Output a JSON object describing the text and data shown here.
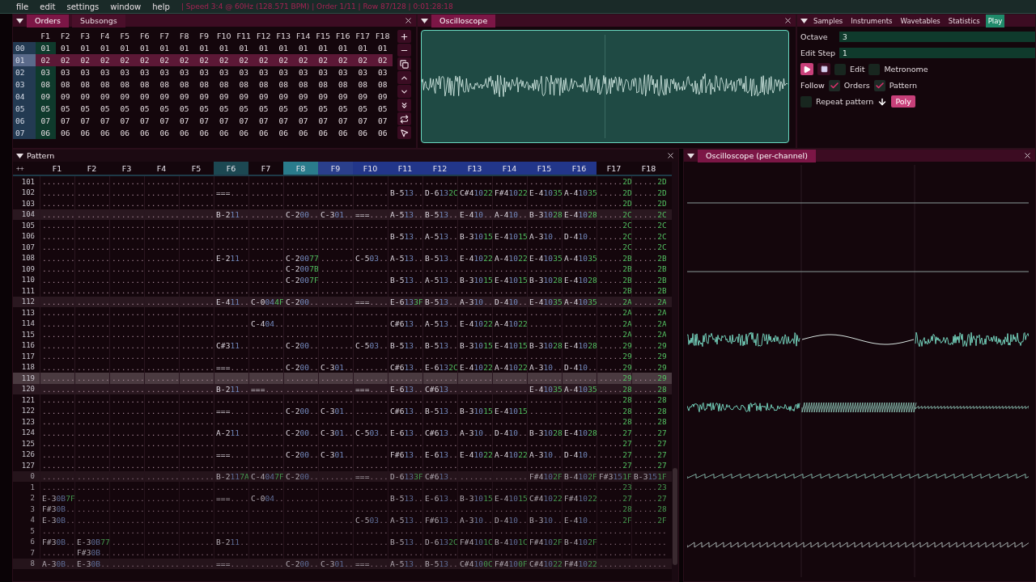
{
  "menu": {
    "items": [
      "file",
      "edit",
      "settings",
      "window",
      "help"
    ],
    "status": "| Speed 3:4 @ 60Hz (128.571 BPM) | Order 1/11 | Row 87/128 | 0:01:28:18"
  },
  "orders": {
    "tabs": [
      {
        "label": "Orders",
        "selected": true
      },
      {
        "label": "Subsongs",
        "selected": false
      }
    ],
    "columns": [
      {
        "label": "F1",
        "selected": true
      },
      {
        "label": "F2",
        "selected": false
      },
      {
        "label": "F3",
        "selected": false
      },
      {
        "label": "F4",
        "selected": false
      },
      {
        "label": "F5",
        "selected": false
      },
      {
        "label": "F6",
        "selected": false
      },
      {
        "label": "F7",
        "selected": false
      },
      {
        "label": "F8",
        "selected": false
      },
      {
        "label": "F9",
        "selected": false
      },
      {
        "label": "F10",
        "selected": false
      },
      {
        "label": "F11",
        "selected": false
      },
      {
        "label": "F12",
        "selected": false
      },
      {
        "label": "F13",
        "selected": false
      },
      {
        "label": "F14",
        "selected": false
      },
      {
        "label": "F15",
        "selected": false
      },
      {
        "label": "F16",
        "selected": false
      },
      {
        "label": "F17",
        "selected": false
      },
      {
        "label": "F18",
        "selected": false
      }
    ],
    "rows": [
      {
        "num": "00",
        "selected": false,
        "cells": [
          "01",
          "01",
          "01",
          "01",
          "01",
          "01",
          "01",
          "01",
          "01",
          "01",
          "01",
          "01",
          "01",
          "01",
          "01",
          "01",
          "01",
          "01"
        ]
      },
      {
        "num": "01",
        "selected": true,
        "cells": [
          "02",
          "02",
          "02",
          "02",
          "02",
          "02",
          "02",
          "02",
          "02",
          "02",
          "02",
          "02",
          "02",
          "02",
          "02",
          "02",
          "02",
          "02"
        ]
      },
      {
        "num": "02",
        "selected": false,
        "cells": [
          "03",
          "03",
          "03",
          "03",
          "03",
          "03",
          "03",
          "03",
          "03",
          "03",
          "03",
          "03",
          "03",
          "03",
          "03",
          "03",
          "03",
          "03"
        ]
      },
      {
        "num": "03",
        "selected": false,
        "cells": [
          "08",
          "08",
          "08",
          "08",
          "08",
          "08",
          "08",
          "08",
          "08",
          "08",
          "08",
          "08",
          "08",
          "08",
          "08",
          "08",
          "08",
          "08"
        ]
      },
      {
        "num": "04",
        "selected": false,
        "cells": [
          "09",
          "09",
          "09",
          "09",
          "09",
          "09",
          "09",
          "09",
          "09",
          "09",
          "09",
          "09",
          "09",
          "09",
          "09",
          "09",
          "09",
          "09"
        ]
      },
      {
        "num": "05",
        "selected": false,
        "cells": [
          "05",
          "05",
          "05",
          "05",
          "05",
          "05",
          "05",
          "05",
          "05",
          "05",
          "05",
          "05",
          "05",
          "05",
          "05",
          "05",
          "05",
          "05"
        ]
      },
      {
        "num": "06",
        "selected": false,
        "cells": [
          "07",
          "07",
          "07",
          "07",
          "07",
          "07",
          "07",
          "07",
          "07",
          "07",
          "07",
          "07",
          "07",
          "07",
          "07",
          "07",
          "07",
          "07"
        ]
      },
      {
        "num": "07",
        "selected": false,
        "cells": [
          "06",
          "06",
          "06",
          "06",
          "06",
          "06",
          "06",
          "06",
          "06",
          "06",
          "06",
          "06",
          "06",
          "06",
          "06",
          "06",
          "06",
          "06"
        ]
      }
    ]
  },
  "oscilloscope": {
    "title": "Oscilloscope"
  },
  "play": {
    "tabs": [
      {
        "label": "Samples",
        "selected": false
      },
      {
        "label": "Instruments",
        "selected": false
      },
      {
        "label": "Wavetables",
        "selected": false
      },
      {
        "label": "Statistics",
        "selected": false
      },
      {
        "label": "Play",
        "selected": true
      }
    ],
    "fields": [
      {
        "label": "Octave",
        "value": "3"
      },
      {
        "label": "Edit Step",
        "value": "1"
      }
    ],
    "controls": [
      {
        "kind": "play"
      },
      {
        "kind": "stop"
      },
      {
        "kind": "check",
        "label": "Edit",
        "checked": false
      },
      {
        "kind": "check",
        "label": "Metronome",
        "checked": false
      }
    ],
    "follow": {
      "label": "Follow",
      "checks": [
        {
          "label": "Orders",
          "checked": true
        },
        {
          "label": "Pattern",
          "checked": true
        }
      ]
    },
    "options": [
      {
        "kind": "check",
        "label": "Repeat pattern",
        "checked": false
      },
      {
        "kind": "arrow"
      },
      {
        "kind": "button",
        "label": "Poly",
        "on": true
      }
    ]
  },
  "pattern": {
    "title": "Pattern",
    "corner": "++",
    "channels": [
      {
        "label": "F1"
      },
      {
        "label": "F2"
      },
      {
        "label": "F3"
      },
      {
        "label": "F4"
      },
      {
        "label": "F5"
      },
      {
        "label": "F6",
        "color": "#1c4852"
      },
      {
        "label": "F7"
      },
      {
        "label": "F8",
        "color": "#2a7c8c"
      },
      {
        "label": "F9",
        "color": "#2a3f8c"
      },
      {
        "label": "F10",
        "color": "#22368a"
      },
      {
        "label": "F11",
        "color": "#22368a"
      },
      {
        "label": "F12",
        "color": "#22368a"
      },
      {
        "label": "F13",
        "color": "#22368a"
      },
      {
        "label": "F14",
        "color": "#22368a"
      },
      {
        "label": "F15",
        "color": "#22368a"
      },
      {
        "label": "F16",
        "color": "#22368a"
      },
      {
        "label": "F17"
      },
      {
        "label": "F18"
      }
    ],
    "rows": [
      {
        "num": "101",
        "beat": false,
        "selected": false,
        "preview": false,
        "cells": [
          ".......",
          ".......",
          ".......",
          ".......",
          ".......",
          ".......",
          ".......",
          ".......",
          ".......",
          ".......",
          ".......",
          ".......",
          ".......",
          ".......",
          ".......",
          ".......",
          ".....2D",
          ".....2D"
        ]
      },
      {
        "num": "102",
        "beat": false,
        "selected": false,
        "preview": false,
        "cells": [
          ".......",
          ".......",
          ".......",
          ".......",
          ".......",
          "===....",
          ".......",
          ".......",
          ".......",
          ".......",
          "B-513..",
          "D-6132C",
          "C#41022",
          "F#41022",
          "E-41035",
          "A-41035",
          ".....2D",
          ".....2D"
        ]
      },
      {
        "num": "103",
        "beat": false,
        "selected": false,
        "preview": false,
        "cells": [
          ".......",
          ".......",
          ".......",
          ".......",
          ".......",
          ".......",
          ".......",
          ".......",
          ".......",
          ".......",
          ".......",
          ".......",
          ".......",
          ".......",
          ".......",
          ".......",
          ".....2D",
          ".....2D"
        ]
      },
      {
        "num": "104",
        "beat": true,
        "selected": false,
        "preview": false,
        "cells": [
          ".......",
          ".......",
          ".......",
          ".......",
          ".......",
          "B-211..",
          ".......",
          "C-200..",
          "C-301..",
          "===....",
          "A-513..",
          "B-513..",
          "E-410..",
          "A-410..",
          "B-31028",
          "E-41028",
          ".....2C",
          ".....2C"
        ]
      },
      {
        "num": "105",
        "beat": false,
        "selected": false,
        "preview": false,
        "cells": [
          ".......",
          ".......",
          ".......",
          ".......",
          ".......",
          ".......",
          ".......",
          ".......",
          ".......",
          ".......",
          ".......",
          ".......",
          ".......",
          ".......",
          ".......",
          ".......",
          ".....2C",
          ".....2C"
        ]
      },
      {
        "num": "106",
        "beat": false,
        "selected": false,
        "preview": false,
        "cells": [
          ".......",
          ".......",
          ".......",
          ".......",
          ".......",
          ".......",
          ".......",
          ".......",
          ".......",
          ".......",
          "B-513..",
          "A-513..",
          "B-31015",
          "E-41015",
          "A-310..",
          "D-410..",
          ".....2C",
          ".....2C"
        ]
      },
      {
        "num": "107",
        "beat": false,
        "selected": false,
        "preview": false,
        "cells": [
          ".......",
          ".......",
          ".......",
          ".......",
          ".......",
          ".......",
          ".......",
          ".......",
          ".......",
          ".......",
          ".......",
          ".......",
          ".......",
          ".......",
          ".......",
          ".......",
          ".....2C",
          ".....2C"
        ]
      },
      {
        "num": "108",
        "beat": false,
        "selected": false,
        "preview": false,
        "cells": [
          ".......",
          ".......",
          ".......",
          ".......",
          ".......",
          "E-211..",
          ".......",
          "C-20077",
          ".......",
          "C-503..",
          "A-513..",
          "B-513..",
          "E-41022",
          "A-41022",
          "E-41035",
          "A-41035",
          ".....2B",
          ".....2B"
        ]
      },
      {
        "num": "109",
        "beat": false,
        "selected": false,
        "preview": false,
        "cells": [
          ".......",
          ".......",
          ".......",
          ".......",
          ".......",
          ".......",
          ".......",
          "C-2007B",
          ".......",
          ".......",
          ".......",
          ".......",
          ".......",
          ".......",
          ".......",
          ".......",
          ".....2B",
          ".....2B"
        ]
      },
      {
        "num": "110",
        "beat": false,
        "selected": false,
        "preview": false,
        "cells": [
          ".......",
          ".......",
          ".......",
          ".......",
          ".......",
          ".......",
          ".......",
          "C-2007F",
          ".......",
          ".......",
          "B-513..",
          "A-513..",
          "B-31015",
          "E-41015",
          "B-31028",
          "E-41028",
          ".....2B",
          ".....2B"
        ]
      },
      {
        "num": "111",
        "beat": false,
        "selected": false,
        "preview": false,
        "cells": [
          ".......",
          ".......",
          ".......",
          ".......",
          ".......",
          ".......",
          ".......",
          ".......",
          ".......",
          ".......",
          ".......",
          ".......",
          ".......",
          ".......",
          ".......",
          ".......",
          ".....2B",
          ".....2B"
        ]
      },
      {
        "num": "112",
        "beat": true,
        "selected": false,
        "preview": false,
        "cells": [
          ".......",
          ".......",
          ".......",
          ".......",
          ".......",
          "E-411..",
          "C-0044F",
          "C-200..",
          ".......",
          "===....",
          "E-6133F",
          "B-513..",
          "A-310..",
          "D-410..",
          "E-41035",
          "A-41035",
          ".....2A",
          ".....2A"
        ]
      },
      {
        "num": "113",
        "beat": false,
        "selected": false,
        "preview": false,
        "cells": [
          ".......",
          ".......",
          ".......",
          ".......",
          ".......",
          ".......",
          ".......",
          ".......",
          ".......",
          ".......",
          ".......",
          ".......",
          ".......",
          ".......",
          ".......",
          ".......",
          ".....2A",
          ".....2A"
        ]
      },
      {
        "num": "114",
        "beat": false,
        "selected": false,
        "preview": false,
        "cells": [
          ".......",
          ".......",
          ".......",
          ".......",
          ".......",
          ".......",
          "C-404..",
          ".......",
          ".......",
          ".......",
          "C#613..",
          "A-513..",
          "E-41022",
          "A-41022",
          ".......",
          ".......",
          ".....2A",
          ".....2A"
        ]
      },
      {
        "num": "115",
        "beat": false,
        "selected": false,
        "preview": false,
        "cells": [
          ".......",
          ".......",
          ".......",
          ".......",
          ".......",
          ".......",
          ".......",
          ".......",
          ".......",
          ".......",
          ".......",
          ".......",
          ".......",
          ".......",
          ".......",
          ".......",
          ".....2A",
          ".....2A"
        ]
      },
      {
        "num": "116",
        "beat": false,
        "selected": false,
        "preview": false,
        "cells": [
          ".......",
          ".......",
          ".......",
          ".......",
          ".......",
          "C#311..",
          ".......",
          "C-200..",
          ".......",
          "C-503..",
          "B-513..",
          "B-513..",
          "B-31015",
          "E-41015",
          "B-31028",
          "E-41028",
          ".....29",
          ".....29"
        ]
      },
      {
        "num": "117",
        "beat": false,
        "selected": false,
        "preview": false,
        "cells": [
          ".......",
          ".......",
          ".......",
          ".......",
          ".......",
          ".......",
          ".......",
          ".......",
          ".......",
          ".......",
          ".......",
          ".......",
          ".......",
          ".......",
          ".......",
          ".......",
          ".....29",
          ".....29"
        ]
      },
      {
        "num": "118",
        "beat": false,
        "selected": false,
        "preview": false,
        "cells": [
          ".......",
          ".......",
          ".......",
          ".......",
          ".......",
          "===....",
          ".......",
          "C-200..",
          "C-301..",
          ".......",
          "C#613..",
          "E-6132C",
          "E-41022",
          "A-41022",
          "A-310..",
          "D-410..",
          ".....29",
          ".....29"
        ]
      },
      {
        "num": "119",
        "beat": false,
        "selected": true,
        "preview": false,
        "cells": [
          ".......",
          ".......",
          ".......",
          ".......",
          ".......",
          ".......",
          ".......",
          ".......",
          ".......",
          ".......",
          ".......",
          ".......",
          ".......",
          ".......",
          ".......",
          ".......",
          ".....29",
          ".....29"
        ]
      },
      {
        "num": "120",
        "beat": true,
        "selected": false,
        "preview": false,
        "cells": [
          ".......",
          ".......",
          ".......",
          ".......",
          ".......",
          "B-211..",
          "===....",
          ".......",
          ".......",
          "===....",
          "E-613..",
          "C#613..",
          ".......",
          ".......",
          "E-41035",
          "A-41035",
          ".....28",
          ".....28"
        ]
      },
      {
        "num": "121",
        "beat": false,
        "selected": false,
        "preview": false,
        "cells": [
          ".......",
          ".......",
          ".......",
          ".......",
          ".......",
          ".......",
          ".......",
          ".......",
          ".......",
          ".......",
          ".......",
          ".......",
          ".......",
          ".......",
          ".......",
          ".......",
          ".....28",
          ".....28"
        ]
      },
      {
        "num": "122",
        "beat": false,
        "selected": false,
        "preview": false,
        "cells": [
          ".......",
          ".......",
          ".......",
          ".......",
          ".......",
          "===....",
          ".......",
          "C-200..",
          "C-301..",
          ".......",
          "C#613..",
          "B-513..",
          "B-31015",
          "E-41015",
          ".......",
          ".......",
          ".....28",
          ".....28"
        ]
      },
      {
        "num": "123",
        "beat": false,
        "selected": false,
        "preview": false,
        "cells": [
          ".......",
          ".......",
          ".......",
          ".......",
          ".......",
          ".......",
          ".......",
          ".......",
          ".......",
          ".......",
          ".......",
          ".......",
          ".......",
          ".......",
          ".......",
          ".......",
          ".....28",
          ".....28"
        ]
      },
      {
        "num": "124",
        "beat": false,
        "selected": false,
        "preview": false,
        "cells": [
          ".......",
          ".......",
          ".......",
          ".......",
          ".......",
          "A-211..",
          ".......",
          "C-200..",
          "C-301..",
          "C-503..",
          "E-613..",
          "C#613..",
          "A-310..",
          "D-410..",
          "B-31028",
          "E-41028",
          ".....27",
          ".....27"
        ]
      },
      {
        "num": "125",
        "beat": false,
        "selected": false,
        "preview": false,
        "cells": [
          ".......",
          ".......",
          ".......",
          ".......",
          ".......",
          ".......",
          ".......",
          ".......",
          ".......",
          ".......",
          ".......",
          ".......",
          ".......",
          ".......",
          ".......",
          ".......",
          ".....27",
          ".....27"
        ]
      },
      {
        "num": "126",
        "beat": false,
        "selected": false,
        "preview": false,
        "cells": [
          ".......",
          ".......",
          ".......",
          ".......",
          ".......",
          "===....",
          ".......",
          "C-200..",
          "C-301..",
          ".......",
          "F#613..",
          "E-613..",
          "E-41022",
          "A-41022",
          "A-310..",
          "D-410..",
          ".....27",
          ".....27"
        ]
      },
      {
        "num": "127",
        "beat": false,
        "selected": false,
        "preview": false,
        "cells": [
          ".......",
          ".......",
          ".......",
          ".......",
          ".......",
          ".......",
          ".......",
          ".......",
          ".......",
          ".......",
          ".......",
          ".......",
          ".......",
          ".......",
          ".......",
          ".......",
          ".....27",
          ".....27"
        ]
      },
      {
        "num": "0",
        "beat": true,
        "selected": false,
        "preview": true,
        "cells": [
          ".......",
          ".......",
          ".......",
          ".......",
          ".......",
          "B-2117A",
          "C-4047F",
          "C-200..",
          ".......",
          "===....",
          "D-6133F",
          "C#613..",
          ".......",
          ".......",
          "F#4102F",
          "B-4102F",
          "F#3151F",
          "B-3151F"
        ]
      },
      {
        "num": "1",
        "beat": false,
        "selected": false,
        "preview": true,
        "cells": [
          ".......",
          ".......",
          ".......",
          ".......",
          ".......",
          ".......",
          ".......",
          ".......",
          ".......",
          ".......",
          ".......",
          ".......",
          ".......",
          ".......",
          ".......",
          ".......",
          ".....23",
          ".....23"
        ]
      },
      {
        "num": "2",
        "beat": false,
        "selected": false,
        "preview": true,
        "cells": [
          "E-30B7F",
          ".......",
          ".......",
          ".......",
          ".......",
          "===....",
          "C-004..",
          ".......",
          ".......",
          ".......",
          "B-513..",
          "E-613..",
          "B-31015",
          "E-41015",
          "C#41022",
          "F#41022",
          ".....27",
          ".....27"
        ]
      },
      {
        "num": "3",
        "beat": false,
        "selected": false,
        "preview": true,
        "cells": [
          "F#30B..",
          ".......",
          ".......",
          ".......",
          ".......",
          ".......",
          ".......",
          ".......",
          ".......",
          ".......",
          ".......",
          ".......",
          ".......",
          ".......",
          ".......",
          ".......",
          ".....28",
          ".....28"
        ]
      },
      {
        "num": "4",
        "beat": false,
        "selected": false,
        "preview": true,
        "cells": [
          "E-30B..",
          ".......",
          ".......",
          ".......",
          ".......",
          ".......",
          ".......",
          ".......",
          ".......",
          "C-503..",
          "A-513..",
          "F#613..",
          "A-310..",
          "D-410..",
          "B-310..",
          "E-410..",
          ".....2F",
          ".....2F"
        ]
      },
      {
        "num": "5",
        "beat": false,
        "selected": false,
        "preview": true,
        "cells": [
          ".......",
          ".......",
          ".......",
          ".......",
          ".......",
          ".......",
          ".......",
          ".......",
          ".......",
          ".......",
          ".......",
          ".......",
          ".......",
          ".......",
          ".......",
          ".......",
          ".......",
          "......."
        ]
      },
      {
        "num": "6",
        "beat": false,
        "selected": false,
        "preview": true,
        "cells": [
          "F#30B..",
          "E-30B77",
          ".......",
          ".......",
          ".......",
          "B-211..",
          ".......",
          ".......",
          ".......",
          ".......",
          "B-513..",
          "D-6132C",
          "F#4101C",
          "B-4101C",
          "F#4102F",
          "B-4102F",
          ".......",
          "......."
        ]
      },
      {
        "num": "7",
        "beat": false,
        "selected": false,
        "preview": true,
        "cells": [
          ".......",
          "F#30B..",
          ".......",
          ".......",
          ".......",
          ".......",
          ".......",
          ".......",
          ".......",
          ".......",
          ".......",
          ".......",
          ".......",
          ".......",
          ".......",
          ".......",
          ".......",
          "......."
        ]
      },
      {
        "num": "8",
        "beat": true,
        "selected": false,
        "preview": true,
        "cells": [
          "A-30B..",
          "E-30B..",
          ".......",
          ".......",
          ".......",
          "===....",
          ".......",
          "C-200..",
          "C-301..",
          "===....",
          "A-513..",
          "B-513..",
          "C#4100C",
          "F#4100F",
          "C#41022",
          "F#41022",
          ".......",
          "......."
        ]
      }
    ]
  },
  "channel_scope": {
    "title": "Oscilloscope (per-channel)"
  }
}
